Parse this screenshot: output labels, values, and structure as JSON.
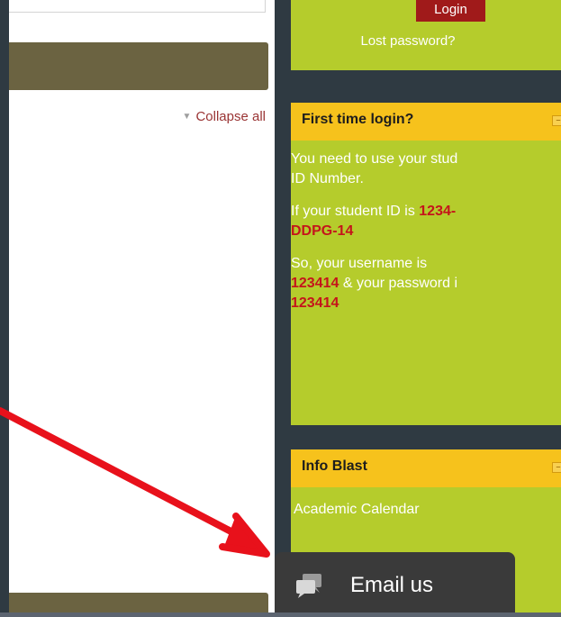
{
  "login": {
    "button_label": "Login",
    "lost_password": "Lost password?"
  },
  "course": {
    "collapse_all": "Collapse all"
  },
  "first_time": {
    "title": "First time login?",
    "line1": "You need to use your stud",
    "line1b": "ID Number.",
    "line2_prefix": "If your student ID is ",
    "line2_id_a": "1234-",
    "line2_id_b": "DDPG-14",
    "line3_prefix": "So, your username is",
    "line3_username": "123414",
    "line3_mid": " & your password i",
    "line3_password": "123414"
  },
  "info_blast": {
    "title": "Info Blast",
    "items": [
      "Academic Calendar"
    ]
  },
  "email": {
    "label": "Email us"
  },
  "colors": {
    "green": "#b5cc2c",
    "yellow": "#f6c21c",
    "olive": "#6b6341",
    "red": "#c4151b",
    "arrow": "#e8111b"
  }
}
